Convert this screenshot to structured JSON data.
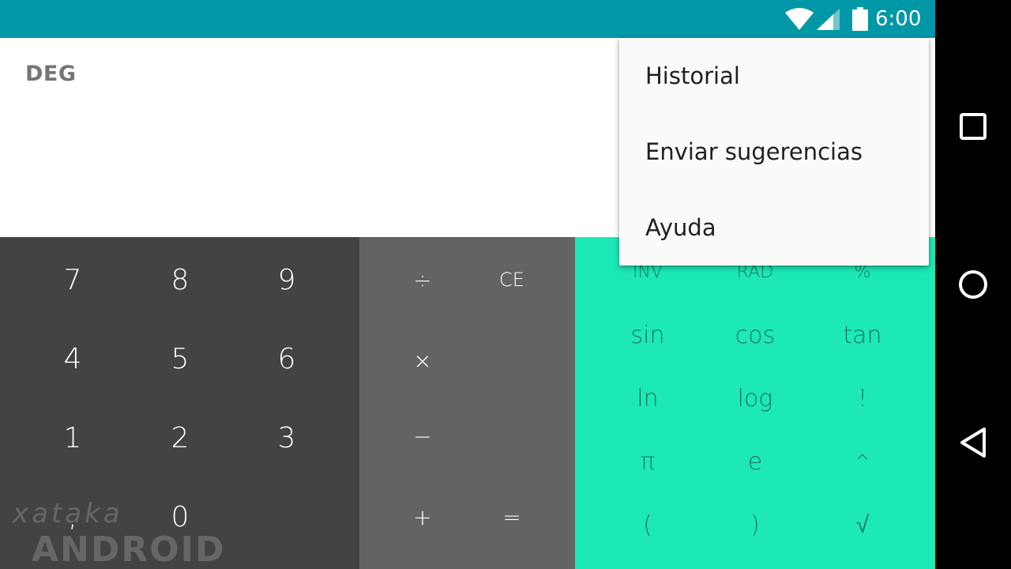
{
  "status_bar": {
    "time": "6:00",
    "color": "#0097a7",
    "icons": [
      "wifi-icon",
      "signal-icon",
      "battery-icon"
    ]
  },
  "display": {
    "angle_mode": "DEG",
    "background": "#ffffff"
  },
  "numpad": {
    "background": "#434343",
    "keys": [
      "7",
      "8",
      "9",
      "4",
      "5",
      "6",
      "1",
      "2",
      "3",
      ",",
      "0"
    ]
  },
  "operators": {
    "background": "#636363",
    "divide": "÷",
    "clear": "CE",
    "multiply": "×",
    "minus": "−",
    "plus": "+",
    "equals": "="
  },
  "advanced": {
    "background": "#1de9b6",
    "keys": [
      "INV",
      "RAD",
      "%",
      "sin",
      "cos",
      "tan",
      "ln",
      "log",
      "!",
      "π",
      "e",
      "^",
      "(",
      ")",
      "√"
    ]
  },
  "overflow_menu": {
    "items": [
      "Historial",
      "Enviar sugerencias",
      "Ayuda"
    ]
  },
  "watermark": {
    "line1": "xataka",
    "line2": "ANDROID"
  },
  "nav_bar": {
    "buttons": [
      "recents-icon",
      "home-icon",
      "back-icon"
    ]
  }
}
